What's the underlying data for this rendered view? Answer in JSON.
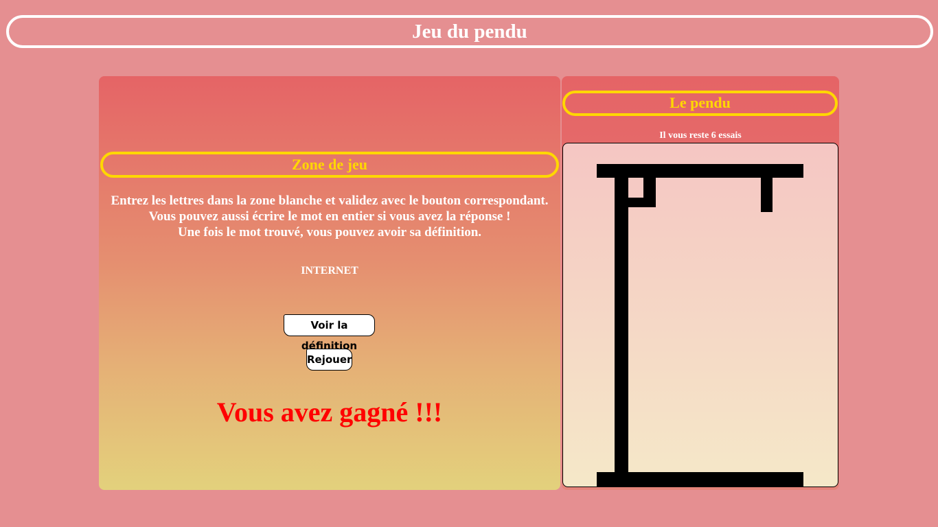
{
  "header": {
    "title": "Jeu du pendu"
  },
  "game": {
    "title": "Zone de jeu",
    "instructions": [
      "Entrez les lettres dans la zone blanche et validez avec le bouton correspondant.",
      "Vous pouvez aussi écrire le mot en entier si vous avez la réponse !",
      "Une fois le mot trouvé, vous pouvez avoir sa définition."
    ],
    "word": "INTERNET",
    "definition_button": "Voir la définition",
    "replay_button": "Rejouer",
    "win_message": "Vous avez gagné !!!"
  },
  "hangman": {
    "title": "Le pendu",
    "tries_left": "Il vous reste 6 essais"
  },
  "colors": {
    "background": "#e58f91",
    "accent_yellow": "#ffd700",
    "win_red": "#ff0000"
  }
}
